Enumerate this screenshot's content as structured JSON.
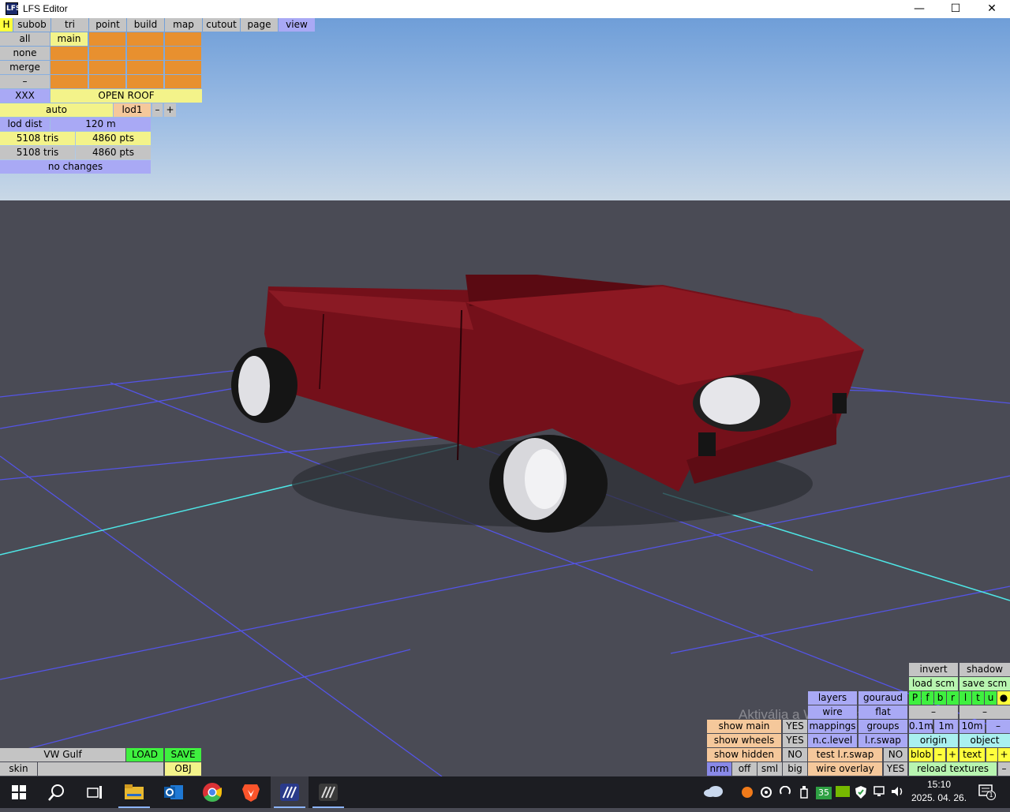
{
  "window": {
    "title": "LFS Editor",
    "minimize": "—",
    "maximize": "☐",
    "close": "✕"
  },
  "top_menu": [
    "H",
    "subob",
    "tri",
    "point",
    "build",
    "map",
    "cutout",
    "page",
    "view"
  ],
  "left_panel": {
    "all": "all",
    "none": "none",
    "merge": "merge",
    "dash": "–",
    "main": "main",
    "xxx": "XXX",
    "open_roof": "OPEN ROOF",
    "auto": "auto",
    "lod1": "lod1",
    "minus": "–",
    "plus": "+",
    "lod_dist_label": "lod dist",
    "lod_dist_value": "120 m",
    "tris1": "5108 tris",
    "pts1": "4860 pts",
    "tris2": "5108 tris",
    "pts2": "4860 pts",
    "status": "no changes"
  },
  "bottom_left": {
    "model": "VW Gulf",
    "load": "LOAD",
    "save": "SAVE",
    "skin": "skin",
    "obj": "OBJ"
  },
  "view_panel": {
    "invert": "invert",
    "shadow": "shadow",
    "load_scm": "load scm",
    "save_scm": "save scm",
    "letters": [
      "P",
      "f",
      "b",
      "r",
      "l",
      "t",
      "u",
      "●"
    ],
    "layers": "layers",
    "gouraud": "gouraud",
    "wire": "wire",
    "flat": "flat",
    "dash1": "–",
    "dash2": "–",
    "show_main": "show main",
    "show_main_val": "YES",
    "mappings": "mappings",
    "groups": "groups",
    "d01": "0.1m",
    "d1": "1m",
    "d10": "10m",
    "d_dash": "–",
    "show_wheels": "show wheels",
    "show_wheels_val": "YES",
    "nc_level": "n.c.level",
    "lr_swap": "l.r.swap",
    "origin": "origin",
    "object": "object",
    "show_hidden": "show hidden",
    "show_hidden_val": "NO",
    "test_lr_swap": "test l.r.swap",
    "test_lr_swap_val": "NO",
    "blob": "blob",
    "blob_minus": "–",
    "blob_plus": "+",
    "text": "text",
    "text_minus": "–",
    "text_plus": "+",
    "nrm": "nrm",
    "off": "off",
    "sml": "sml",
    "big": "big",
    "wire_overlay": "wire overlay",
    "wire_overlay_val": "YES",
    "reload_textures": "reload textures",
    "rt_dash": "–"
  },
  "watermark": "Aktiválja a Windowst",
  "taskbar": {
    "time": "15:10",
    "date": "2025. 04. 26.",
    "badge": "35",
    "notif": "1"
  },
  "colors": {
    "car_body": "#7a0a12",
    "grid_blue": "#5050e0",
    "grid_cyan": "#40e0e0"
  }
}
